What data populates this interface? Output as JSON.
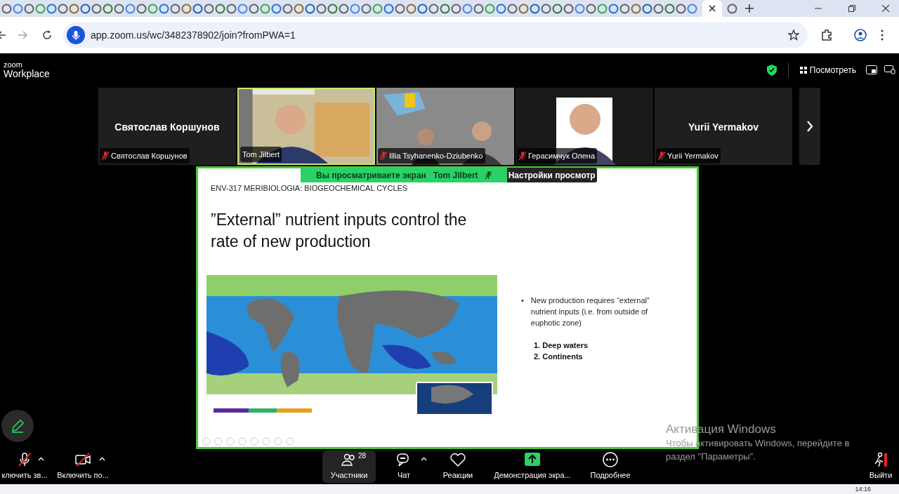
{
  "browser": {
    "url": "app.zoom.us/wc/3482378902/join?fromPWA=1"
  },
  "zoom_header": {
    "logo_small": "zoom",
    "logo": "Workplace",
    "view_button": "Посмотреть"
  },
  "participants": [
    {
      "kind": "name",
      "display": "Святослав Коршунов",
      "label": "Святослав Коршунов",
      "muted": true,
      "speaking": false
    },
    {
      "kind": "video",
      "label": "Tom Jilbert",
      "muted": false,
      "speaking": true
    },
    {
      "kind": "video",
      "label": "Illia Tsyhanenko-Dziubenko",
      "muted": true,
      "speaking": false
    },
    {
      "kind": "video",
      "label": "Герасимчук Олена",
      "muted": true,
      "speaking": false
    },
    {
      "kind": "name",
      "display": "Yurii Yermakov",
      "label": "Yurii Yermakov",
      "muted": true,
      "speaking": false
    }
  ],
  "share_banner": {
    "text": "Вы просматриваете экран",
    "presenter": "Tom Jilbert",
    "settings": "Настройки просмотр"
  },
  "slide": {
    "header": "ENV-317 MERIBIOLOGIA: BIOGEOCHEMICAL CYCLES",
    "title": "”External” nutrient inputs control the rate of new production",
    "bullet_mark": "•",
    "bullet": "New production requires “external” nutrient inputs (i.e. from outside of euphotic zone)",
    "numbered": [
      "1. Deep waters",
      "2. Continents"
    ]
  },
  "activation": {
    "title": "Активация Windows",
    "text": "Чтобы активировать Windows, перейдите в раздел \"Параметры\"."
  },
  "toolbar": [
    {
      "kind": "mic",
      "label": "ключить зв...",
      "caret": true,
      "selected": false
    },
    {
      "kind": "camera",
      "label": "Включить по...",
      "caret": true,
      "selected": false
    },
    {
      "kind": "participants",
      "label": "Участники",
      "count": "28",
      "caret": false,
      "selected": true
    },
    {
      "kind": "chat",
      "label": "Чат",
      "caret": true,
      "selected": false
    },
    {
      "kind": "reactions",
      "label": "Реакции",
      "caret": false,
      "selected": false
    },
    {
      "kind": "share",
      "label": "Демонстрация экра...",
      "caret": false,
      "selected": false
    },
    {
      "kind": "more",
      "label": "Подробнее",
      "caret": false,
      "selected": false
    },
    {
      "kind": "leave",
      "label": "Выйти",
      "caret": false,
      "selected": false
    }
  ],
  "taskbar": {
    "time": "14:16"
  }
}
